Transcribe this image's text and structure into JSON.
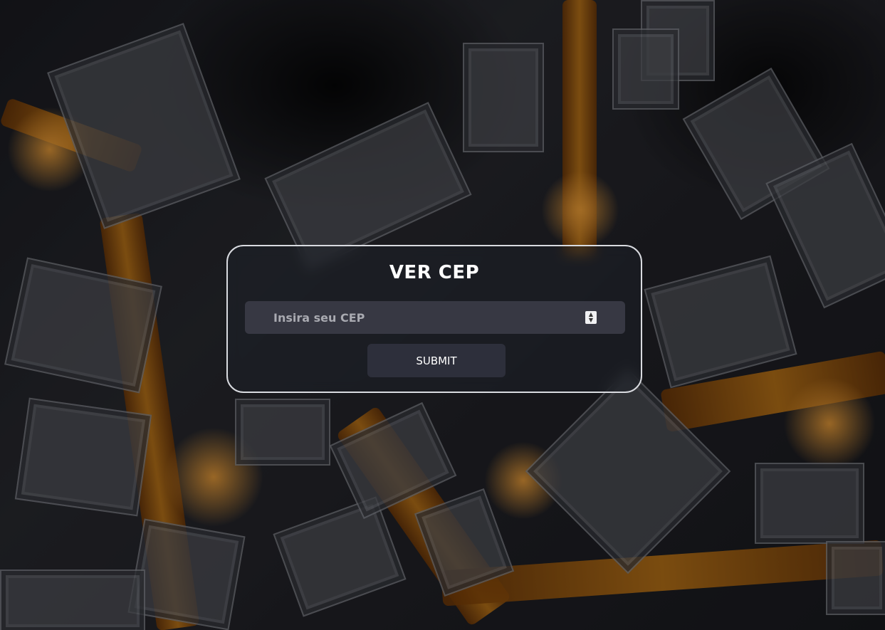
{
  "form": {
    "title": "VER CEP",
    "cep_placeholder": "Insira seu CEP",
    "submit_label": "SUBMIT"
  },
  "colors": {
    "card_border": "#d9dbe0",
    "title_text": "#ffffff",
    "input_bg": "#3e404c",
    "button_bg": "#30323e",
    "background_glow": "#d88416"
  },
  "icons": {
    "spinner_up": "chevron-up-icon",
    "spinner_down": "chevron-down-icon"
  }
}
